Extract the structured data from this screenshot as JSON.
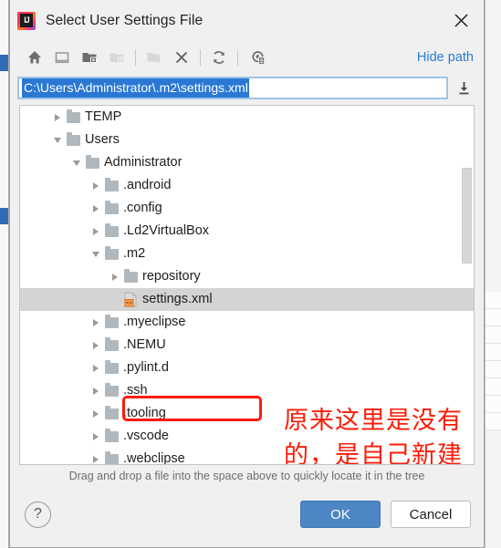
{
  "window": {
    "title": "Select User Settings File",
    "app_icon": "intellij-idea-logo",
    "close_icon": "close-icon"
  },
  "toolbar": {
    "items": [
      {
        "name": "home-icon",
        "label": "Home",
        "enabled": true
      },
      {
        "name": "desktop-icon",
        "label": "Desktop",
        "enabled": true
      },
      {
        "name": "project-folder-icon",
        "label": "Project Directory",
        "enabled": true
      },
      {
        "name": "module-folder-icon",
        "label": "Module Directory",
        "enabled": false
      },
      {
        "name": "new-folder-icon",
        "label": "New Folder",
        "enabled": false
      },
      {
        "name": "delete-icon",
        "label": "Delete",
        "enabled": true
      },
      {
        "name": "refresh-icon",
        "label": "Refresh",
        "enabled": true
      },
      {
        "name": "show-hidden-files-icon",
        "label": "Show Hidden Files and Directories",
        "enabled": true
      }
    ],
    "hide_path_label": "Hide path"
  },
  "path_bar": {
    "value": "C:\\Users\\Administrator\\.m2\\settings.xml",
    "selected": true,
    "dropdown_icon": "download-arrow-icon"
  },
  "tree": {
    "rows": [
      {
        "indent": 1,
        "twisty": "right",
        "icon": "folder-icon",
        "label": "TEMP",
        "selected": false
      },
      {
        "indent": 1,
        "twisty": "down",
        "icon": "folder-icon",
        "label": "Users",
        "selected": false
      },
      {
        "indent": 2,
        "twisty": "down",
        "icon": "folder-icon",
        "label": "Administrator",
        "selected": false
      },
      {
        "indent": 3,
        "twisty": "right",
        "icon": "folder-icon",
        "label": ".android",
        "selected": false
      },
      {
        "indent": 3,
        "twisty": "right",
        "icon": "folder-icon",
        "label": ".config",
        "selected": false
      },
      {
        "indent": 3,
        "twisty": "right",
        "icon": "folder-icon",
        "label": ".Ld2VirtualBox",
        "selected": false
      },
      {
        "indent": 3,
        "twisty": "down",
        "icon": "folder-icon",
        "label": ".m2",
        "selected": false
      },
      {
        "indent": 4,
        "twisty": "right",
        "icon": "folder-icon",
        "label": "repository",
        "selected": false
      },
      {
        "indent": 4,
        "twisty": "none",
        "icon": "xml-file-icon",
        "label": "settings.xml",
        "selected": true
      },
      {
        "indent": 3,
        "twisty": "right",
        "icon": "folder-icon",
        "label": ".myeclipse",
        "selected": false
      },
      {
        "indent": 3,
        "twisty": "right",
        "icon": "folder-icon",
        "label": ".NEMU",
        "selected": false
      },
      {
        "indent": 3,
        "twisty": "right",
        "icon": "folder-icon",
        "label": ".pylint.d",
        "selected": false
      },
      {
        "indent": 3,
        "twisty": "right",
        "icon": "folder-icon",
        "label": ".ssh",
        "selected": false
      },
      {
        "indent": 3,
        "twisty": "right",
        "icon": "folder-icon",
        "label": ".tooling",
        "selected": false
      },
      {
        "indent": 3,
        "twisty": "right",
        "icon": "folder-icon",
        "label": ".vscode",
        "selected": false
      },
      {
        "indent": 3,
        "twisty": "right",
        "icon": "folder-icon",
        "label": ".webclipse",
        "selected": false
      }
    ]
  },
  "annotation": {
    "highlight_target": "settings.xml",
    "text": "原来这里是没有的，是自己新建的。",
    "color": "#fb1c07"
  },
  "hint": {
    "text": "Drag and drop a file into the space above to quickly locate it in the tree"
  },
  "footer": {
    "help_label": "?",
    "ok_label": "OK",
    "cancel_label": "Cancel",
    "ok_color": "#4d86c4"
  }
}
